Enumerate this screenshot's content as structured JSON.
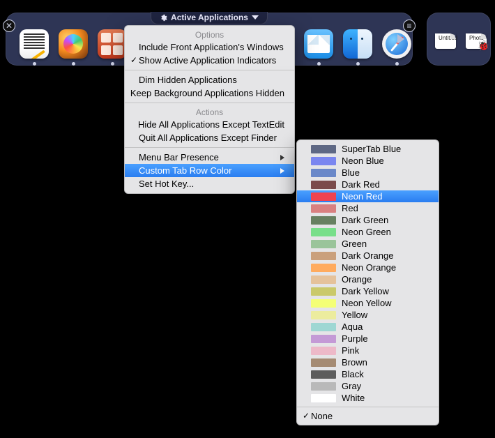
{
  "bar": {
    "title": "Active Applications",
    "apps": [
      {
        "name": "TextEdit",
        "cls": "textedit"
      },
      {
        "name": "iPhoto",
        "cls": "iphoto"
      },
      {
        "name": "Photo Booth",
        "cls": "photobooth"
      },
      {
        "name": "Mail",
        "cls": "mail"
      },
      {
        "name": "Finder",
        "cls": "finder"
      },
      {
        "name": "Safari",
        "cls": "safari"
      }
    ]
  },
  "desktop": [
    {
      "label": "Untitled",
      "emoji": ""
    },
    {
      "label": "Photo",
      "emoji": "🐞"
    }
  ],
  "menu": {
    "sections": [
      {
        "header": "Options",
        "items": [
          {
            "label": "Include Front Application's Windows",
            "checked": false
          },
          {
            "label": "Show Active Application Indicators",
            "checked": true
          }
        ]
      },
      {
        "items": [
          {
            "label": "Dim Hidden Applications"
          },
          {
            "label": "Keep Background Applications Hidden"
          }
        ]
      },
      {
        "header": "Actions",
        "items": [
          {
            "label": "Hide All Applications Except TextEdit"
          },
          {
            "label": "Quit All Applications Except Finder"
          }
        ]
      },
      {
        "items": [
          {
            "label": "Menu Bar Presence",
            "submenu": true
          },
          {
            "label": "Custom Tab Row Color",
            "submenu": true,
            "highlight": true
          },
          {
            "label": "Set Hot Key..."
          }
        ]
      }
    ]
  },
  "colors": {
    "items": [
      {
        "label": "SuperTab Blue",
        "hex": "#5e6884"
      },
      {
        "label": "Neon Blue",
        "hex": "#7a86f0"
      },
      {
        "label": "Blue",
        "hex": "#6a88c9"
      },
      {
        "label": "Dark Red",
        "hex": "#7b4b4b"
      },
      {
        "label": "Neon Red",
        "hex": "#ef4350",
        "highlight": true
      },
      {
        "label": "Red",
        "hex": "#d98080"
      },
      {
        "label": "Dark Green",
        "hex": "#678061"
      },
      {
        "label": "Neon Green",
        "hex": "#78df8a"
      },
      {
        "label": "Green",
        "hex": "#9ac49a"
      },
      {
        "label": "Dark Orange",
        "hex": "#caa07c"
      },
      {
        "label": "Neon Orange",
        "hex": "#ffab5e"
      },
      {
        "label": "Orange",
        "hex": "#e5c29b"
      },
      {
        "label": "Dark Yellow",
        "hex": "#cac96a"
      },
      {
        "label": "Neon Yellow",
        "hex": "#f4ff76"
      },
      {
        "label": "Yellow",
        "hex": "#ecec9e"
      },
      {
        "label": "Aqua",
        "hex": "#9ed7d3"
      },
      {
        "label": "Purple",
        "hex": "#c49ad6"
      },
      {
        "label": "Pink",
        "hex": "#edb9c8"
      },
      {
        "label": "Brown",
        "hex": "#a58b73"
      },
      {
        "label": "Black",
        "hex": "#5c5c5c"
      },
      {
        "label": "Gray",
        "hex": "#b9b9b9"
      },
      {
        "label": "White",
        "hex": "#ffffff"
      }
    ],
    "none_label": "None",
    "none_checked": true
  }
}
